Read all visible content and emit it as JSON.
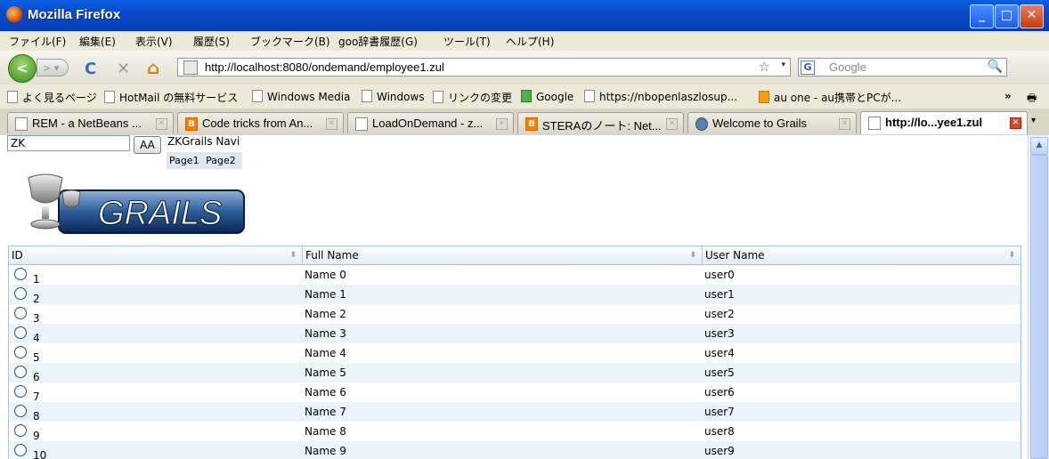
{
  "window": {
    "title": "Mozilla Firefox",
    "min_label": "_",
    "max_label": "□",
    "close_label": "✕"
  },
  "menu": {
    "items": [
      "ファイル(F)",
      "編集(E)",
      "表示(V)",
      "履歴(S)",
      "ブックマーク(B)",
      "goo辞書履歴(G)",
      "ツール(T)",
      "ヘルプ(H)"
    ]
  },
  "nav": {
    "back_label": "<",
    "forward_label": "> ▾",
    "reload_icon": "C",
    "stop_icon": "✕",
    "home_icon": "⌂",
    "url": "http://localhost:8080/ondemand/employee1.zul",
    "search_placeholder": "Google",
    "search_engine_icon": "G"
  },
  "bookmarks": [
    "よく見るページ",
    "HotMail の無料サービス",
    "Windows Media",
    "Windows",
    "リンクの変更",
    "Google",
    "https://nbopenlaszlosup...",
    "au one - au携帯とPCが..."
  ],
  "tabs": [
    {
      "label": "REM - a NetBeans ...",
      "icon": "doc"
    },
    {
      "label": "Code tricks from An...",
      "icon": "blog"
    },
    {
      "label": "LoadOnDemand - z...",
      "icon": "doc"
    },
    {
      "label": "STERAのノート: Net...",
      "icon": "blog"
    },
    {
      "label": "Welcome to Grails",
      "icon": "grails"
    },
    {
      "label": "http://lo...yee1.zul",
      "icon": "doc",
      "active": true
    }
  ],
  "page": {
    "input_value": "ZK",
    "button_label": "AA",
    "navi_title": "ZKGrails Navi",
    "navi_tabs": [
      "Page1",
      "Page2"
    ],
    "logo_text": "GRAILS"
  },
  "grid": {
    "columns": [
      "ID",
      "Full Name",
      "User Name"
    ],
    "rows": [
      {
        "id": "1",
        "name": "Name 0",
        "user": "user0"
      },
      {
        "id": "2",
        "name": "Name 1",
        "user": "user1"
      },
      {
        "id": "3",
        "name": "Name 2",
        "user": "user2"
      },
      {
        "id": "4",
        "name": "Name 3",
        "user": "user3"
      },
      {
        "id": "5",
        "name": "Name 4",
        "user": "user4"
      },
      {
        "id": "6",
        "name": "Name 5",
        "user": "user5"
      },
      {
        "id": "7",
        "name": "Name 6",
        "user": "user6"
      },
      {
        "id": "8",
        "name": "Name 7",
        "user": "user7"
      },
      {
        "id": "9",
        "name": "Name 8",
        "user": "user8"
      },
      {
        "id": "10",
        "name": "Name 9",
        "user": "user9"
      }
    ]
  }
}
